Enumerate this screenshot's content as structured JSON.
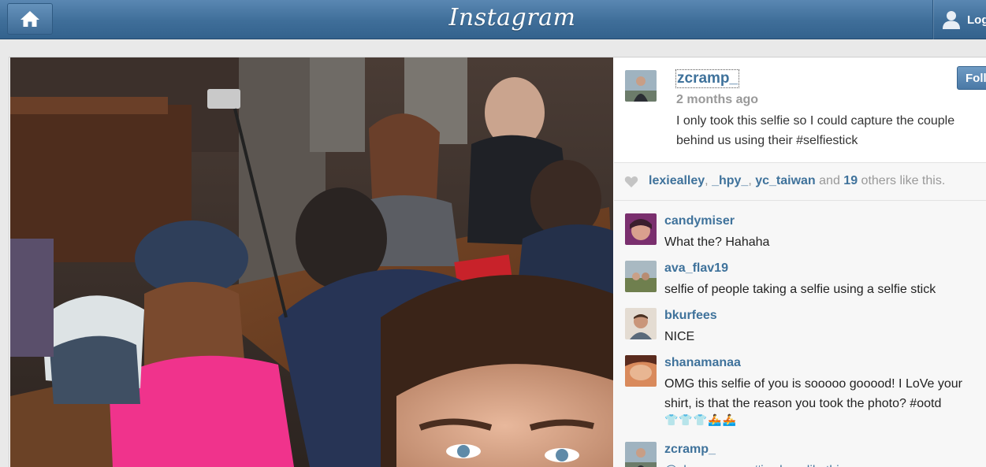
{
  "app": {
    "logo": "Instagram",
    "user_menu_label": "Log"
  },
  "post": {
    "username": "zcramp_",
    "time": "2 months ago",
    "caption": "I only took this selfie so I could capture the couple behind us using their #selfiestick",
    "follow_label": "Foll"
  },
  "likes": {
    "likers": [
      "lexiealley",
      "_hpy_",
      "yc_taiwan"
    ],
    "and_text": "and",
    "others_count": "19",
    "suffix": "others like this."
  },
  "comments": [
    {
      "user": "candymiser",
      "text": "What the? Hahaha"
    },
    {
      "user": "ava_flav19",
      "text": "selfie of people taking a selfie using a selfie stick"
    },
    {
      "user": "bkurfees",
      "text": "NICE"
    },
    {
      "user": "shanamanaa",
      "text": "OMG this selfie of you is sooooo gooood! I LoVe your shirt, is that the reason you took the photo? #ootd",
      "emoji": "👕👕👕🚣🚣"
    },
    {
      "user": "zcramp_",
      "text": "@shanamanaa #iwokeuplikethis"
    }
  ],
  "colors": {
    "brand_blue": "#3f729b",
    "topbar": "#3f6e99",
    "muted": "#999999"
  }
}
